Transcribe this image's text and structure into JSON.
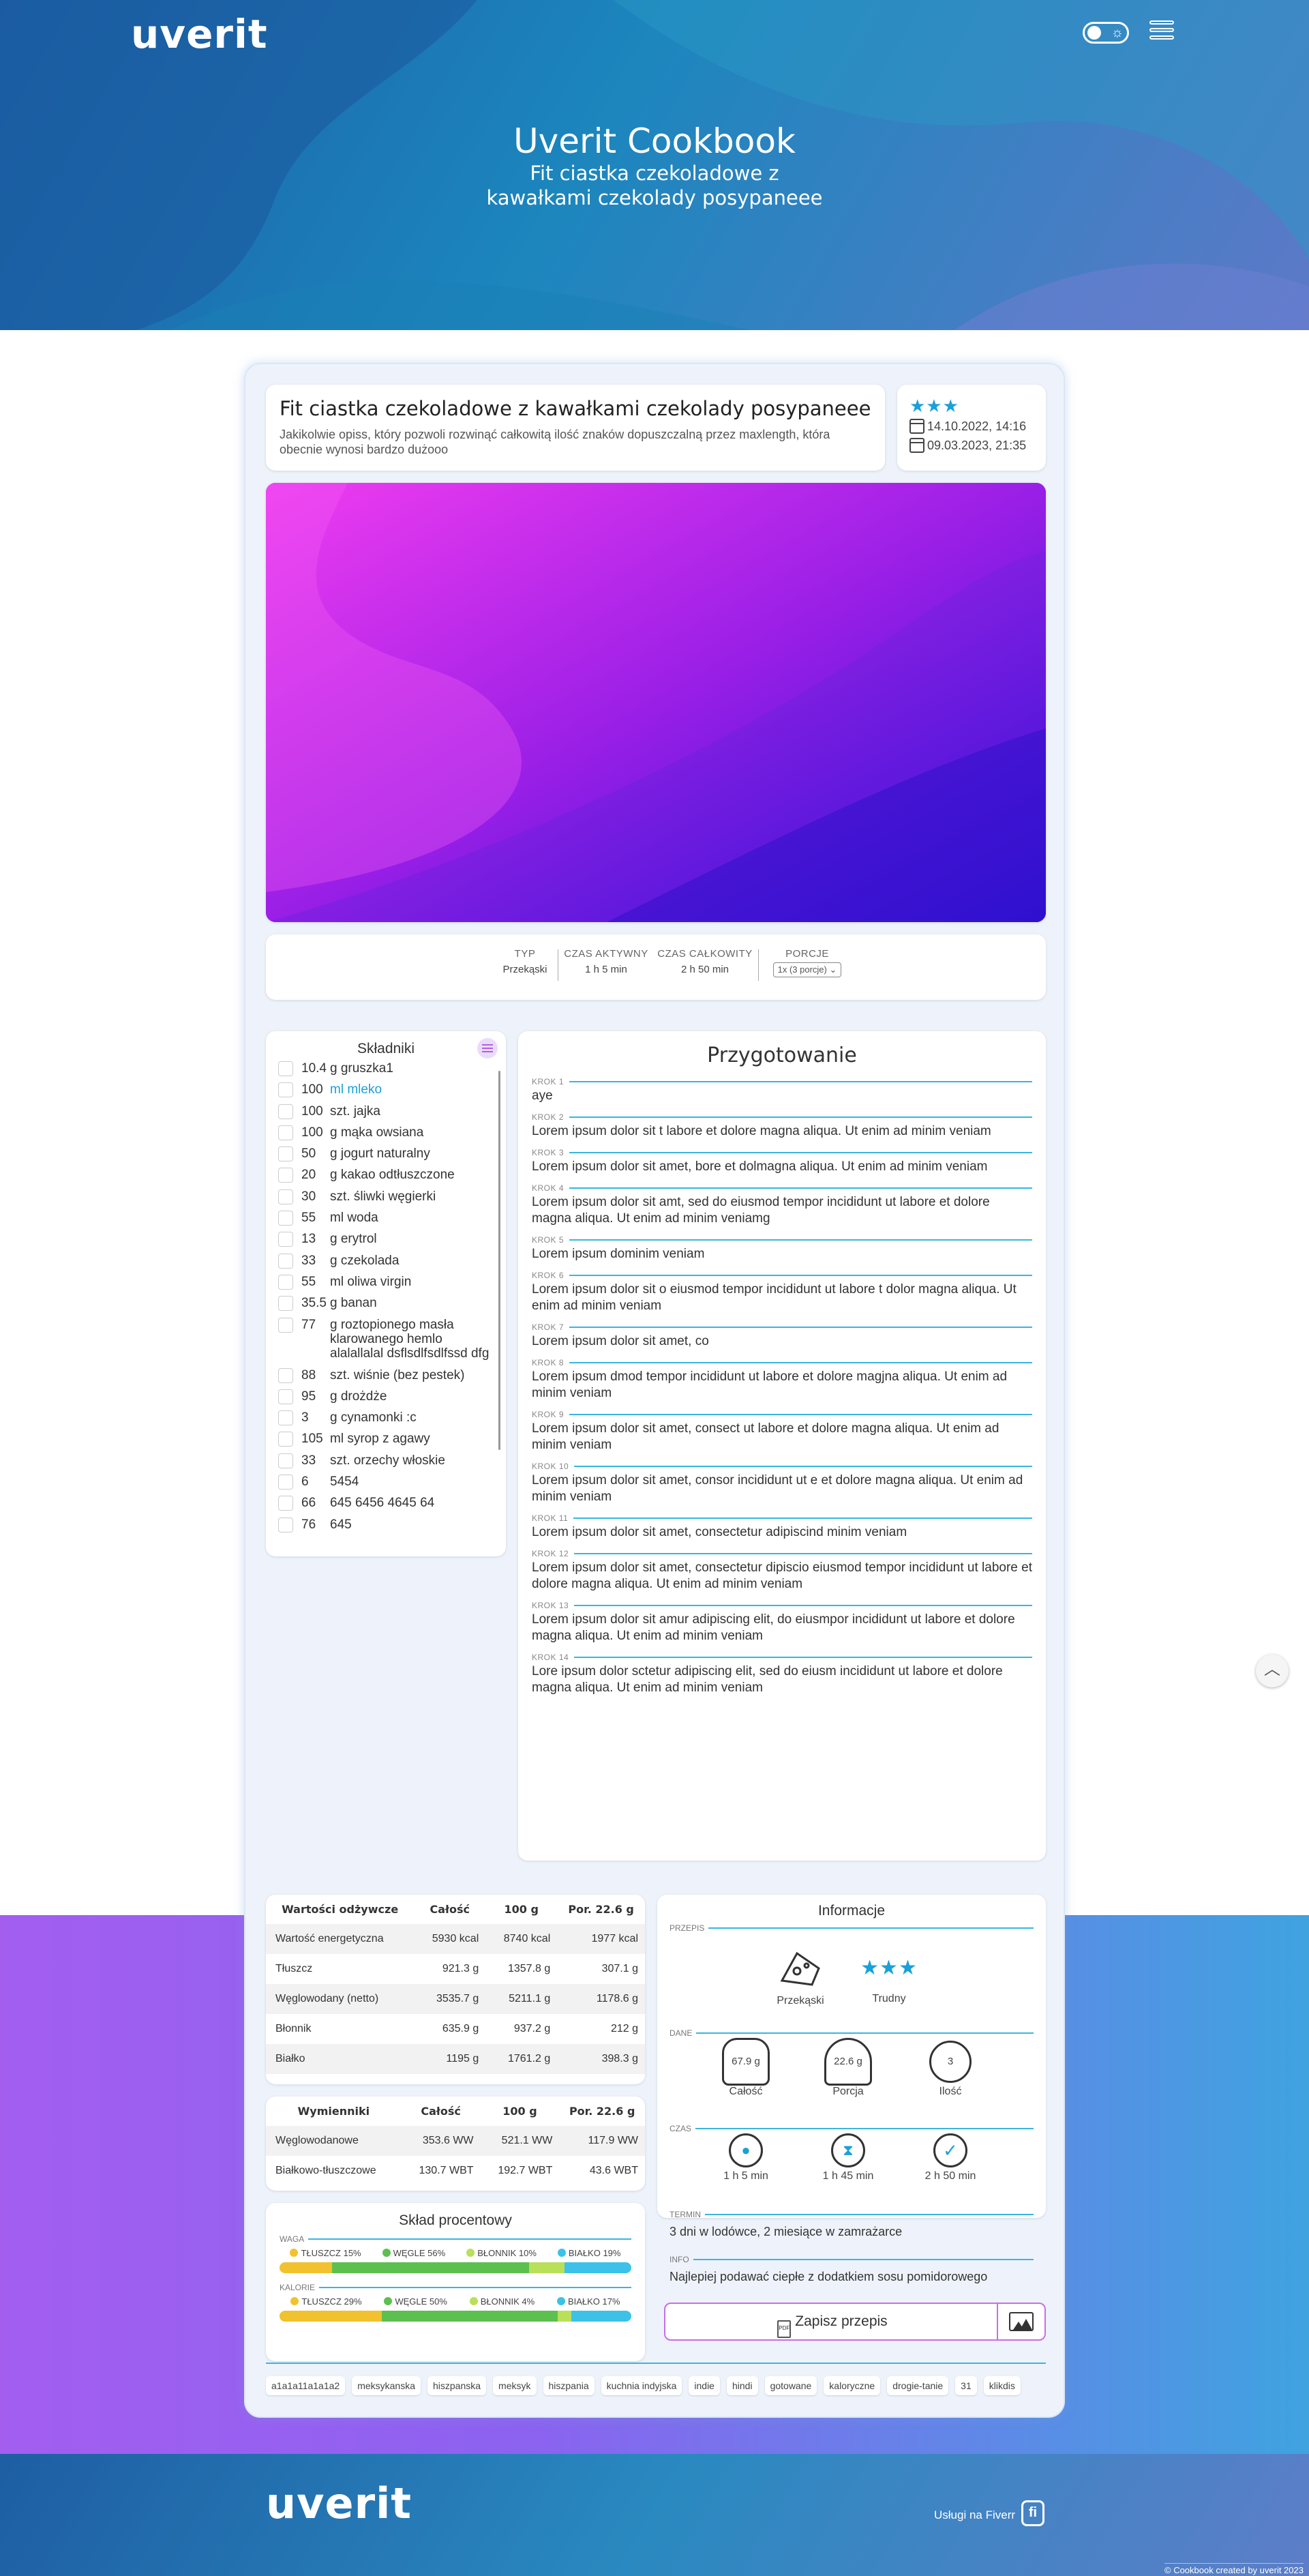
{
  "header": {
    "logo": "uverit",
    "title": "Uverit Cookbook",
    "subtitle": "Fit ciastka czekoladowe z kawałkami czekolady posypaneee",
    "theme_icon": "sun-icon",
    "menu_icon": "hamburger-icon"
  },
  "recipe": {
    "title": "Fit ciastka czekoladowe z kawałkami czekolady posypaneee",
    "description": "Jakikolwie opiss, który pozwoli rozwinąć całkowitą ilość znaków dopuszczalną przez maxlength, która obecnie wynosi bardzo dużooo",
    "rating_stars": "★★★",
    "created": "14.10.2022, 14:16",
    "modified": "09.03.2023, 21:35"
  },
  "times": {
    "type_label": "TYP",
    "type_value": "Przekąski",
    "active_label": "CZAS AKTYWNY",
    "active_value": "1 h 5 min",
    "total_label": "CZAS CAŁKOWITY",
    "total_value": "2 h 50 min",
    "portions_label": "PORCJE",
    "portions_value": "1x (3 porcje)"
  },
  "ingredients": {
    "header": "Składniki",
    "items": [
      {
        "qty": "10.4",
        "name": "g gruszka1"
      },
      {
        "qty": "100",
        "name": "ml mleko",
        "highlight": true
      },
      {
        "qty": "100",
        "name": "szt. jajka"
      },
      {
        "qty": "100",
        "name": "g mąka owsiana"
      },
      {
        "qty": "50",
        "name": "g jogurt naturalny"
      },
      {
        "qty": "20",
        "name": "g kakao odtłuszczone"
      },
      {
        "qty": "30",
        "name": "szt. śliwki węgierki"
      },
      {
        "qty": "55",
        "name": "ml woda"
      },
      {
        "qty": "13",
        "name": "g erytrol"
      },
      {
        "qty": "33",
        "name": "g czekolada"
      },
      {
        "qty": "55",
        "name": "ml oliwa virgin"
      },
      {
        "qty": "35.5",
        "name": "g banan"
      },
      {
        "qty": "77",
        "name": "g roztopionego masła klarowanego hemlo alalallalal dsflsdlfsdlfssd dfg"
      },
      {
        "qty": "88",
        "name": "szt. wiśnie (bez pestek)"
      },
      {
        "qty": "95",
        "name": "g drożdże"
      },
      {
        "qty": "3",
        "name": "g cynamonki :c"
      },
      {
        "qty": "105",
        "name": "ml syrop z agawy"
      },
      {
        "qty": "33",
        "name": "szt. orzechy włoskie"
      },
      {
        "qty": "6",
        "name": "5454"
      },
      {
        "qty": "66",
        "name": "645 6456 4645 64"
      },
      {
        "qty": "76",
        "name": "645"
      }
    ]
  },
  "preparation": {
    "header": "Przygotowanie",
    "steps": [
      {
        "label": "KROK 1",
        "text": "aye"
      },
      {
        "label": "KROK 2",
        "text": "Lorem ipsum dolor sit t labore et dolore magna aliqua. Ut enim ad minim veniam"
      },
      {
        "label": "KROK 3",
        "text": "Lorem ipsum dolor sit amet, bore et dolmagna aliqua. Ut enim ad minim veniam"
      },
      {
        "label": "KROK 4",
        "text": "Lorem ipsum dolor sit amt, sed do eiusmod tempor incididunt ut labore et dolore magna aliqua. Ut enim ad minim veniamg"
      },
      {
        "label": "KROK 5",
        "text": "Lorem ipsum dominim veniam"
      },
      {
        "label": "KROK 6",
        "text": "Lorem ipsum dolor sit o eiusmod tempor incididunt ut labore t dolor magna aliqua. Ut enim ad minim veniam"
      },
      {
        "label": "KROK 7",
        "text": "Lorem ipsum dolor sit amet, co"
      },
      {
        "label": "KROK 8",
        "text": "Lorem ipsum dmod tempor incididunt ut labore et dolore magjna aliqua. Ut enim ad minim veniam"
      },
      {
        "label": "KROK 9",
        "text": "Lorem ipsum dolor sit amet, consect ut labore et dolore magna aliqua. Ut enim ad minim veniam"
      },
      {
        "label": "KROK 10",
        "text": "Lorem ipsum dolor sit amet, consor incididunt ut e et dolore magna aliqua. Ut enim ad minim veniam"
      },
      {
        "label": "KROK 11",
        "text": "Lorem ipsum dolor sit amet, consectetur adipiscind minim veniam"
      },
      {
        "label": "KROK 12",
        "text": "Lorem ipsum dolor sit amet, consectetur dipiscio eiusmod tempor incididunt ut labore et dolore magna aliqua. Ut enim ad minim veniam"
      },
      {
        "label": "KROK 13",
        "text": "Lorem ipsum dolor sit amur adipiscing elit, do eiusmpor incididunt ut labore et dolore magna aliqua. Ut enim ad minim veniam"
      },
      {
        "label": "KROK 14",
        "text": "Lore ipsum dolor sctetur adipiscing elit, sed do eiusm incididunt ut labore et dolore magna aliqua. Ut enim ad minim veniam"
      }
    ]
  },
  "nutrition": {
    "headers": [
      "Wartości odżywcze",
      "Całość",
      "100 g",
      "Por. 22.6 g"
    ],
    "rows": [
      [
        "Wartość energetyczna",
        "5930 kcal",
        "8740 kcal",
        "1977 kcal"
      ],
      [
        "Tłuszcz",
        "921.3 g",
        "1357.8 g",
        "307.1 g"
      ],
      [
        "Węglowodany (netto)",
        "3535.7 g",
        "5211.1 g",
        "1178.6 g"
      ],
      [
        "Błonnik",
        "635.9 g",
        "937.2 g",
        "212 g"
      ],
      [
        "Białko",
        "1195 g",
        "1761.2 g",
        "398.3 g"
      ]
    ]
  },
  "exchangers": {
    "headers": [
      "Wymienniki",
      "Całość",
      "100 g",
      "Por. 22.6 g"
    ],
    "rows": [
      [
        "Węglowodanowe",
        "353.6 WW",
        "521.1 WW",
        "117.9 WW"
      ],
      [
        "Białkowo-tłuszczowe",
        "130.7 WBT",
        "192.7 WBT",
        "43.6 WBT"
      ]
    ]
  },
  "composition": {
    "header": "Skład procentowy",
    "weight_label": "WAGA",
    "weight_legend": [
      "TŁUSZCZ 15%",
      "WĘGLE 56%",
      "BŁONNIK 10%",
      "BIAŁKO 19%"
    ],
    "weight_values": [
      15,
      56,
      10,
      19
    ],
    "calories_label": "KALORIE",
    "calories_legend": [
      "TŁUSZCZ 29%",
      "WĘGLE 50%",
      "BŁONNIK 4%",
      "BIAŁKO 17%"
    ],
    "calories_values": [
      29,
      50,
      4,
      17
    ],
    "colors": [
      "#f2c12e",
      "#5cc04e",
      "#b8e058",
      "#3cc2e8"
    ]
  },
  "info": {
    "header": "Informacje",
    "recipe_label": "PRZEPIS",
    "category": "Przekąski",
    "difficulty": "Trudny",
    "difficulty_stars": "★★★",
    "data_label": "DANE",
    "whole_weight": "67.9 g",
    "whole_label": "Całość",
    "portion_weight": "22.6 g",
    "portion_label": "Porcja",
    "count": "3",
    "count_label": "Ilość",
    "time_label": "CZAS",
    "time_active": "1 h 5 min",
    "time_wait": "1 h 45 min",
    "time_total": "2 h 50 min",
    "term_label": "TERMIN",
    "term_text": "3 dni w lodówce, 2 miesiące w zamrażarce",
    "info_label": "INFO",
    "info_text": "Najlepiej podawać ciepłe z dodatkiem sosu pomidorowego"
  },
  "actions": {
    "save_label": "Zapisz przepis",
    "pdf_icon": "pdf-icon",
    "image_icon": "image-icon"
  },
  "tags": [
    "a1a1a11a1a1a2",
    "meksykanska",
    "hiszpanska",
    "meksyk",
    "hiszpania",
    "kuchnia indyjska",
    "indie",
    "hindi",
    "gotowane",
    "kaloryczne",
    "drogie-tanie",
    "31",
    "klikdis"
  ],
  "footer": {
    "logo": "uverit",
    "fiverr_text": "Usługi na Fiverr",
    "fiverr_icon": "fi",
    "copyright": "© Cookbook created by uverit 2023"
  }
}
